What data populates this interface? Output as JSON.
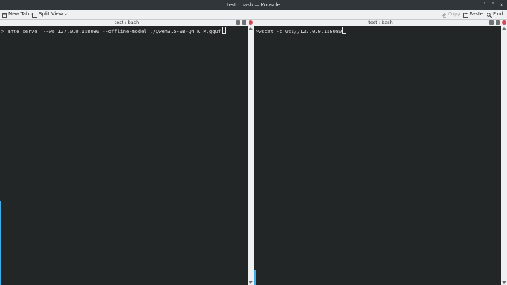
{
  "window": {
    "title": "test : bash — Konsole",
    "minimize": "ˇ",
    "maximize": "ˆ",
    "close": "×"
  },
  "toolbar": {
    "new_tab": "New Tab",
    "split_view": "Split View",
    "copy": "Copy",
    "paste": "Paste",
    "find": "Find"
  },
  "panes": [
    {
      "title": "test : bash",
      "prompt": "> ",
      "command": "ante serve  --ws 127.0.0.1:8080 --offline-model ./Qwen3.5-9B-Q4_K_M.gguf"
    },
    {
      "title": "test : bash",
      "prompt": ">",
      "command": "wscat -c ws://127.0.0.1:8080"
    }
  ],
  "colors": {
    "accent": "#3daee9",
    "terminal_bg": "#232627",
    "close": "#da4453"
  }
}
